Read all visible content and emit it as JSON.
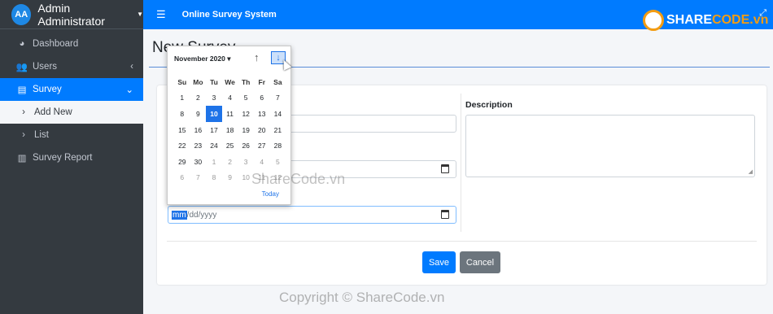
{
  "sidebar": {
    "avatar_initials": "AA",
    "user_name": "Admin Administrator",
    "items": [
      {
        "label": "Dashboard"
      },
      {
        "label": "Users"
      },
      {
        "label": "Survey"
      },
      {
        "label": "Add New"
      },
      {
        "label": "List"
      },
      {
        "label": "Survey Report"
      }
    ]
  },
  "topbar": {
    "title": "Online Survey System"
  },
  "page": {
    "title": "New Survey"
  },
  "form": {
    "description_label": "Description",
    "date_placeholder_mm": "mm",
    "date_placeholder_rest": "/dd/yyyy",
    "save_label": "Save",
    "cancel_label": "Cancel"
  },
  "calendar": {
    "month_year": "November 2020",
    "weekdays": [
      "Su",
      "Mo",
      "Tu",
      "We",
      "Th",
      "Fr",
      "Sa"
    ],
    "days": [
      [
        "1",
        "2",
        "3",
        "4",
        "5",
        "6",
        "7"
      ],
      [
        "8",
        "9",
        "10",
        "11",
        "12",
        "13",
        "14"
      ],
      [
        "15",
        "16",
        "17",
        "18",
        "19",
        "20",
        "21"
      ],
      [
        "22",
        "23",
        "24",
        "25",
        "26",
        "27",
        "28"
      ],
      [
        "29",
        "30",
        "1",
        "2",
        "3",
        "4",
        "5"
      ],
      [
        "6",
        "7",
        "8",
        "9",
        "10",
        "11",
        "12"
      ]
    ],
    "selected_day": "10",
    "today_label": "Today"
  },
  "watermarks": {
    "middle": "ShareCode.vn",
    "bottom": "Copyright © ShareCode.vn",
    "logo_share": "SHARE",
    "logo_code": "CODE.vn"
  },
  "colors": {
    "accent": "#007bff",
    "sidebar": "#343a40",
    "secondary": "#6c757d"
  }
}
